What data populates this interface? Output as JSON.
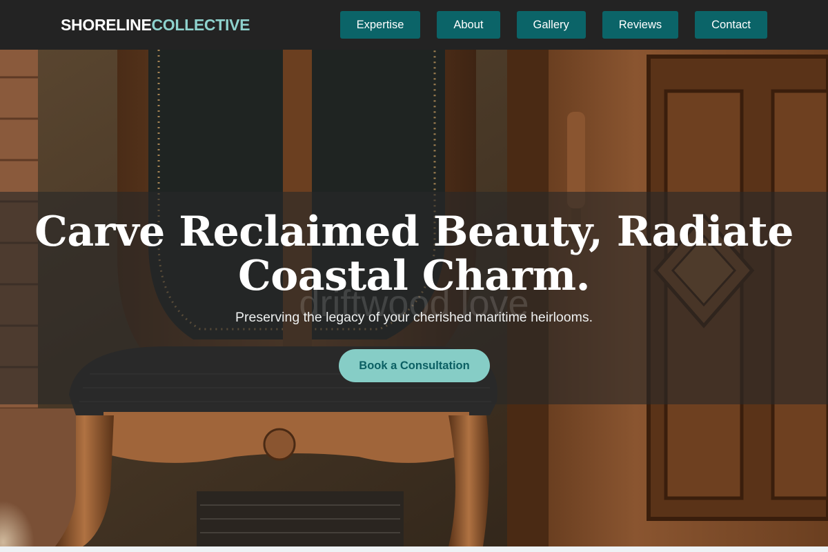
{
  "brand": {
    "name_part1": "SHORELINE",
    "name_part2": "COLLECTIVE",
    "accent_color": "#8ed2cd"
  },
  "nav": {
    "items": [
      {
        "label": "Expertise"
      },
      {
        "label": "About"
      },
      {
        "label": "Gallery"
      },
      {
        "label": "Reviews"
      },
      {
        "label": "Contact"
      }
    ],
    "button_color": "#0b6468"
  },
  "hero": {
    "title": "Carve Reclaimed Beauty, Radiate Coastal Charm.",
    "watermark": "driftwood love",
    "subtitle": "Preserving the legacy of your cherished maritime heirlooms.",
    "cta_label": "Book a Consultation",
    "cta_color": "#86cdc6",
    "background_image": "antique carved wooden chair with dark upholstered seat beside an ornately carved wooden cabinet door"
  }
}
